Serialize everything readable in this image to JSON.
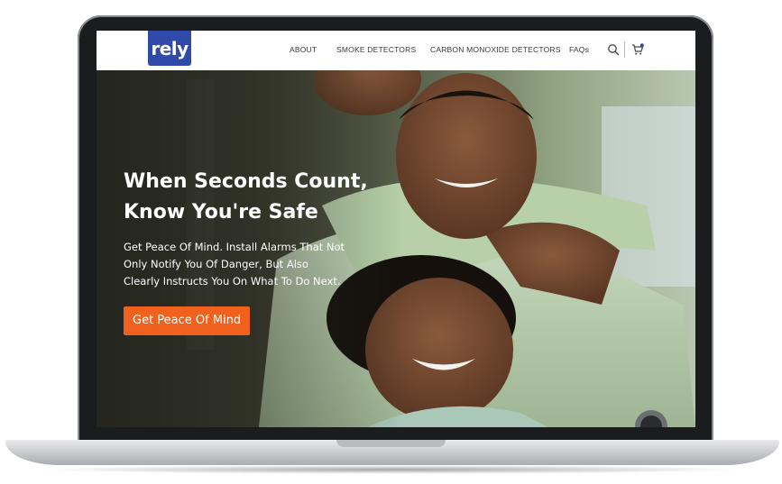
{
  "nav": {
    "logo_text": "rely",
    "links": [
      {
        "label": "ABOUT"
      },
      {
        "label": "SMOKE DETECTORS"
      },
      {
        "label": "CARBON MONOXIDE DETECTORS"
      },
      {
        "label": "FAQs"
      }
    ],
    "icons": [
      "search-icon",
      "cart-icon"
    ]
  },
  "hero": {
    "title_line1": "When Seconds Count,",
    "title_line2": "Know You're Safe",
    "subtitle_line1": "Get Peace Of Mind. Install Alarms That Not",
    "subtitle_line2": "Only Notify You Of Danger, But Also",
    "subtitle_line3": "Clearly Instructs You On What To Do Next.",
    "cta_label": "Get Peace Of Mind"
  },
  "colors": {
    "brand_blue": "#2f4aa8",
    "cta_orange": "#f0611e",
    "cart_badge": "#2f4aa8"
  }
}
